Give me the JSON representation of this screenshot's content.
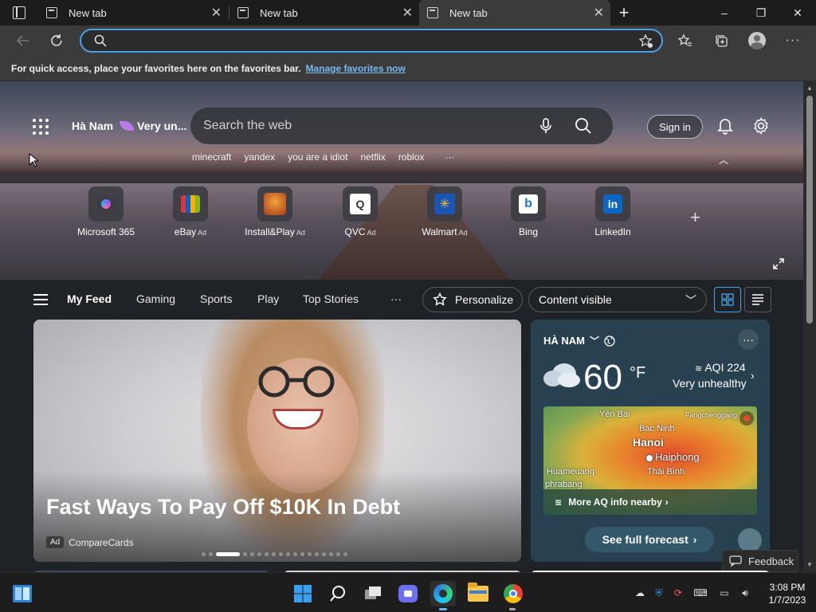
{
  "tabs": [
    {
      "title": "New tab",
      "active": false
    },
    {
      "title": "New tab",
      "active": false
    },
    {
      "title": "New tab",
      "active": true
    }
  ],
  "window_controls": {
    "minimize": "–",
    "restore": "❐",
    "close": "✕"
  },
  "toolbar": {
    "address_value": "",
    "address_placeholder": ""
  },
  "favorites_bar": {
    "message": "For quick access, place your favorites here on the favorites bar.",
    "link": "Manage favorites now"
  },
  "hero": {
    "location": "Hà Nam",
    "air_quality_short": "Very un...",
    "search_placeholder": "Search the web",
    "sign_in": "Sign in",
    "trending": [
      "minecraft",
      "yandex",
      "you are a idiot",
      "netflix",
      "roblox"
    ],
    "more_trending": "···",
    "quick_links": [
      {
        "label": "Microsoft 365",
        "ad": ""
      },
      {
        "label": "eBay",
        "ad": "Ad"
      },
      {
        "label": "Install&Play",
        "ad": "Ad"
      },
      {
        "label": "QVC",
        "ad": "Ad"
      },
      {
        "label": "Walmart",
        "ad": "Ad"
      },
      {
        "label": "Bing",
        "ad": ""
      },
      {
        "label": "LinkedIn",
        "ad": ""
      }
    ]
  },
  "feed_nav": {
    "items": [
      "My Feed",
      "Gaming",
      "Sports",
      "Play",
      "Top Stories"
    ],
    "more": "···",
    "personalize": "Personalize",
    "content_visibility": "Content visible"
  },
  "hero_card": {
    "headline": "Fast Ways To Pay Off $10K In Debt",
    "ad_tag": "Ad",
    "source": "CompareCards"
  },
  "weather": {
    "place": "HÀ NAM",
    "temperature": "60",
    "unit": "°F",
    "aqi": "AQI 224",
    "aqi_desc": "Very unhealthy",
    "map_labels": {
      "yen_bai": "Yên Bái",
      "fangchenggang": "Fangchenggang",
      "bac_ninh": "Bac Ninh",
      "hanoi": "Hanoi",
      "haiphong": "Haiphong",
      "huameuang": "Huameuang",
      "thai_binh": "Thái Bình",
      "phrabang": "phrabang"
    },
    "aq_link": "More AQ info nearby",
    "forecast": "See full forecast"
  },
  "feedback": "Feedback",
  "clock": {
    "time": "3:08 PM",
    "date": "1/7/2023"
  }
}
